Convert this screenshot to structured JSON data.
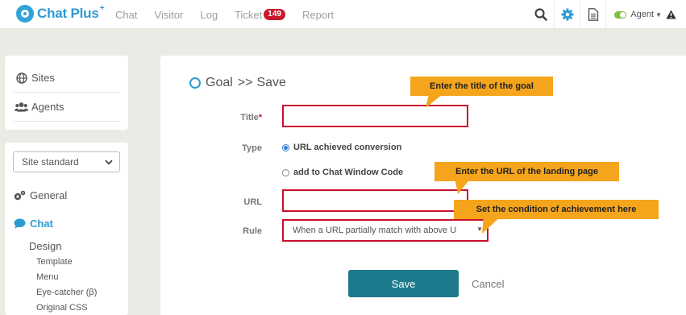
{
  "brand": {
    "name": "Chat Plus",
    "superscript": "+",
    "accent": "#2d9bd2"
  },
  "nav": {
    "items": [
      {
        "label": "Chat"
      },
      {
        "label": "Visitor"
      },
      {
        "label": "Log"
      },
      {
        "label": "Ticket",
        "badge": "149"
      },
      {
        "label": "Report"
      }
    ]
  },
  "toolbar": {
    "icons": [
      "search-icon",
      "gear-icon",
      "document-icon"
    ],
    "agent_label": "Agent",
    "agent_status_color": "#7bbf3e"
  },
  "sidebar": {
    "top_links": [
      {
        "label": "Sites",
        "icon": "globe-icon"
      },
      {
        "label": "Agents",
        "icon": "users-icon"
      }
    ],
    "site_select": {
      "value": "Site standard"
    },
    "sections": [
      {
        "label": "General",
        "icon": "gears-icon"
      },
      {
        "label": "Chat",
        "icon": "chat-bubble-icon",
        "active": true
      }
    ],
    "sub_heading": "Design",
    "sub_items": [
      "Template",
      "Menu",
      "Eye-catcher (β)",
      "Original CSS"
    ]
  },
  "form": {
    "heading_goal": "Goal",
    "heading_sep": ">>",
    "heading_action": "Save",
    "title_label": "Title",
    "required_mark": "*",
    "type_label": "Type",
    "type_options": [
      {
        "label": "URL achieved conversion",
        "selected": true
      },
      {
        "label": "add to Chat Window Code",
        "selected": false
      }
    ],
    "url_label": "URL",
    "rule_label": "Rule",
    "rule_value": "When a URL partially match with above U",
    "save_label": "Save",
    "cancel_label": "Cancel",
    "highlight_color": "#c8102e",
    "save_color": "#1d7a8c"
  },
  "callouts": {
    "color": "#f5a51c",
    "title_hint": "Enter the title of the goal",
    "url_hint": "Enter the URL of the landing page",
    "rule_hint": "Set the condition of achievement here"
  }
}
